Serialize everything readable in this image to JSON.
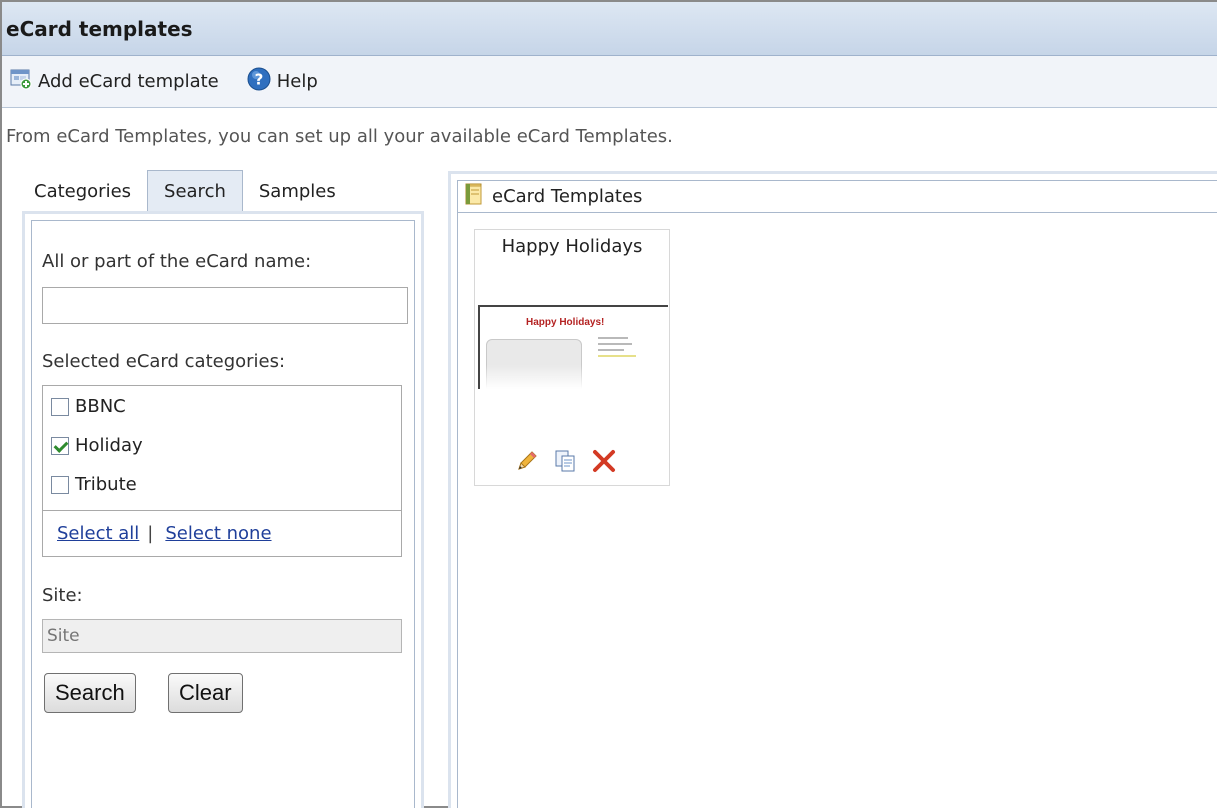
{
  "window": {
    "title": "eCard templates"
  },
  "toolbar": {
    "add_label": "Add eCard template",
    "help_label": "Help"
  },
  "description": "From eCard Templates, you can set up all your available eCard Templates.",
  "left_panel": {
    "tabs": [
      {
        "label": "Categories",
        "active": false
      },
      {
        "label": "Search",
        "active": true
      },
      {
        "label": "Samples",
        "active": false
      }
    ],
    "name_label": "All or part of the eCard name:",
    "name_value": "",
    "categories_label": "Selected eCard categories:",
    "categories": [
      {
        "label": "BBNC",
        "checked": false
      },
      {
        "label": "Holiday",
        "checked": true
      },
      {
        "label": "Tribute",
        "checked": false
      }
    ],
    "select_all": "Select all",
    "separator": "|",
    "select_none": "Select none",
    "site_label": "Site:",
    "site_placeholder": "Site",
    "search_button": "Search",
    "clear_button": "Clear"
  },
  "right_panel": {
    "title": "eCard Templates",
    "cards": [
      {
        "title": "Happy Holidays",
        "thumbnail_heading": "Happy Holidays!"
      }
    ]
  },
  "icons": {
    "add": "add-template-icon",
    "help": "help-icon",
    "folder": "folder-icon",
    "edit": "pencil-icon",
    "copy": "copy-icon",
    "delete": "delete-x-icon"
  },
  "colors": {
    "title_bar": "#c6d5e8",
    "link": "#1f3f9a",
    "delete": "#d33a24",
    "checkmark": "#2e8b2e"
  }
}
